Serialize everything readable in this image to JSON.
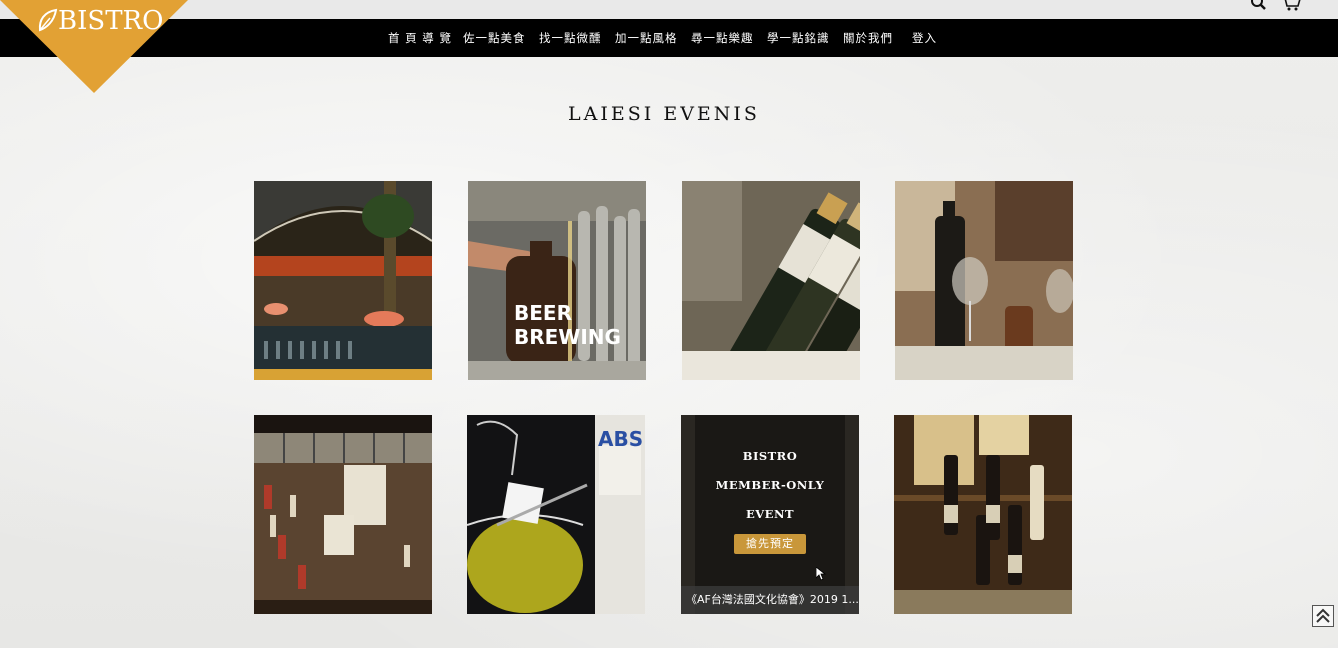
{
  "brand": {
    "name": "BISTRO",
    "color": "#e2a134"
  },
  "nav": {
    "items": [
      {
        "label": "首 頁 導 覽"
      },
      {
        "label": "佐一點美食"
      },
      {
        "label": "找一點微醺"
      },
      {
        "label": "加一點風格"
      },
      {
        "label": "尋一點樂趣"
      },
      {
        "label": "學一點銘識"
      },
      {
        "label": "關於我們"
      },
      {
        "label": "登入"
      }
    ]
  },
  "icons": {
    "search": "search-icon",
    "cart": "cart-icon",
    "scroll_top": "double-chevron-up-icon"
  },
  "section": {
    "title": "LAIESI EVENIS"
  },
  "events": [
    {
      "name": "restaurant-interior-photo"
    },
    {
      "name": "beer-tap-photo",
      "bottle_text": "BEER BREWING"
    },
    {
      "name": "wine-bottles-photo"
    },
    {
      "name": "wine-glasses-table-photo"
    },
    {
      "name": "japanese-shop-photo"
    },
    {
      "name": "absinthe-glass-photo",
      "label_text": "ABS"
    },
    {
      "name": "member-event",
      "lines": [
        "BISTRO",
        "MEMBER-ONLY",
        "EVENT"
      ],
      "button": "搶先預定",
      "caption": "《AF台灣法國文化協會》2019 1..."
    },
    {
      "name": "wine-bar-shelf-photo"
    }
  ]
}
